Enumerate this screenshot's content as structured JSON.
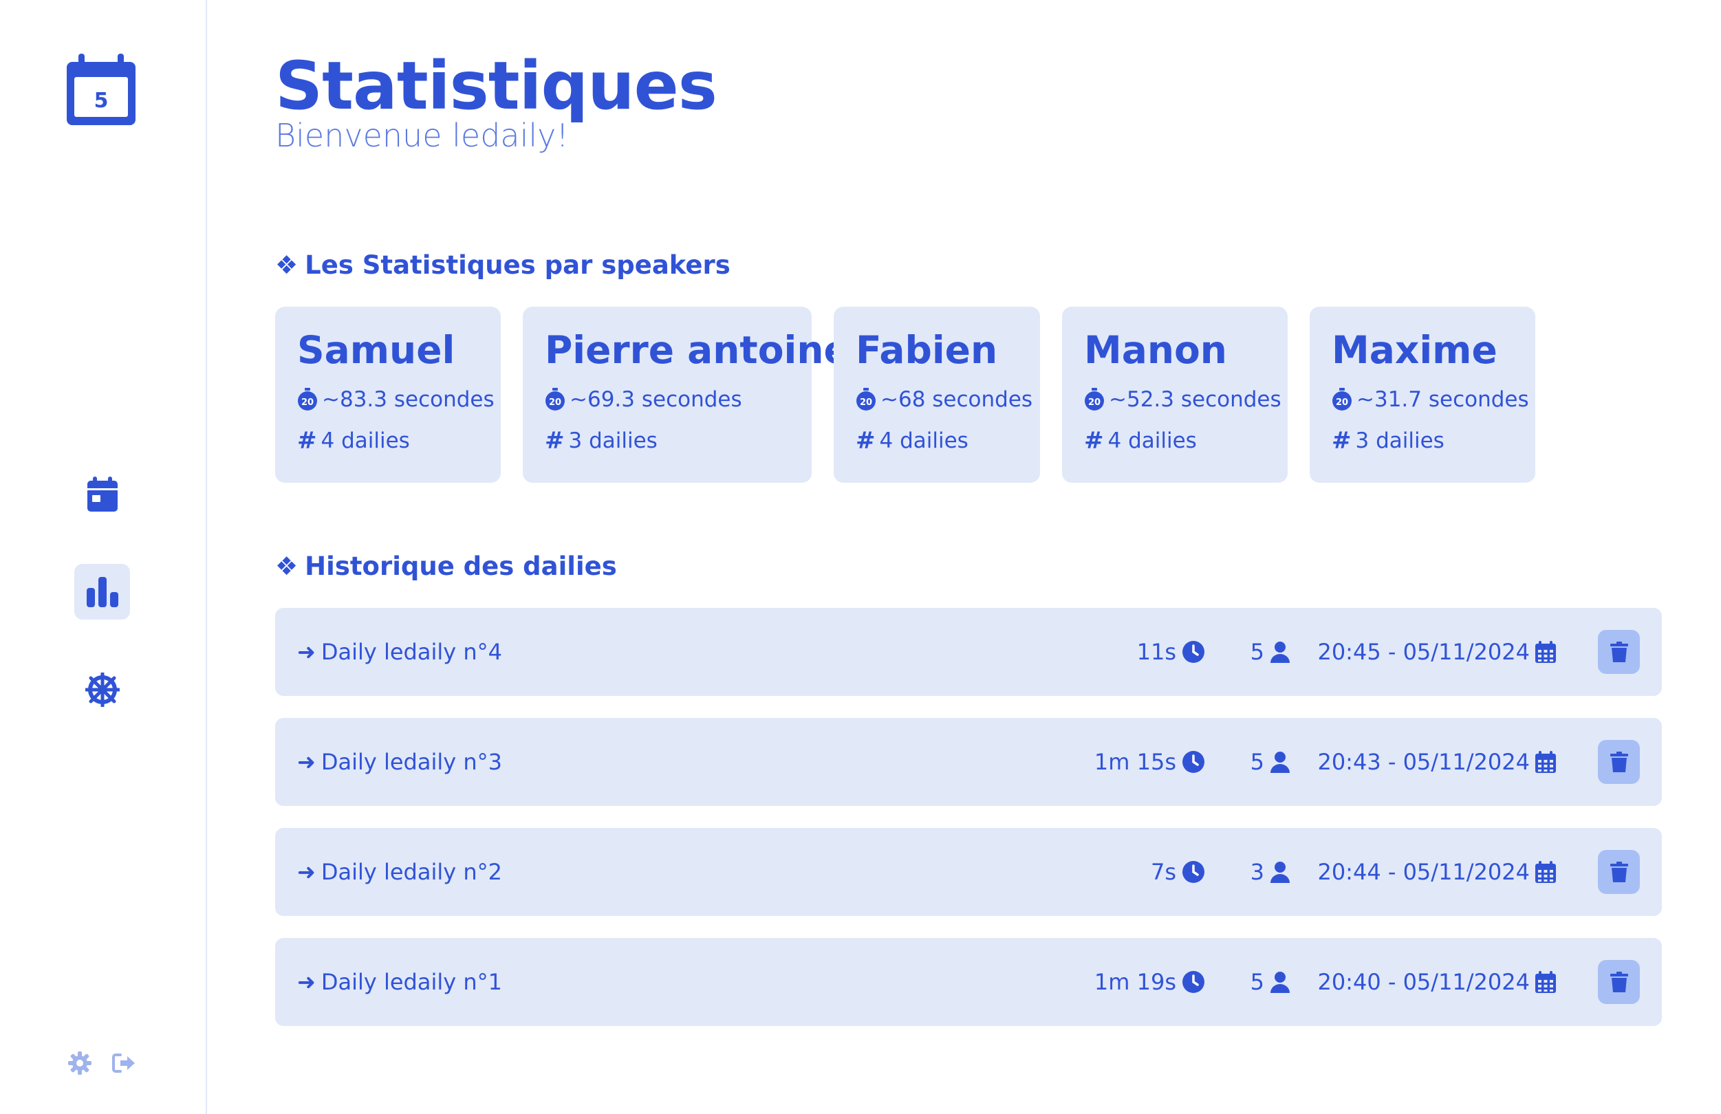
{
  "app": {
    "logo_day": "5"
  },
  "header": {
    "title": "Statistiques",
    "subtitle": "Bienvenue ledaily!"
  },
  "speakers_section": {
    "title": "Les Statistiques par speakers",
    "bullet": "❖"
  },
  "speakers": [
    {
      "name": "Samuel",
      "avg": "~83.3 secondes",
      "dailies": "4 dailies"
    },
    {
      "name": "Pierre antoine",
      "avg": "~69.3 secondes",
      "dailies": "3 dailies"
    },
    {
      "name": "Fabien",
      "avg": "~68 secondes",
      "dailies": "4 dailies"
    },
    {
      "name": "Manon",
      "avg": "~52.3 secondes",
      "dailies": "4 dailies"
    },
    {
      "name": "Maxime",
      "avg": "~31.7 secondes",
      "dailies": "3 dailies"
    }
  ],
  "history_section": {
    "title": "Historique des dailies",
    "bullet": "❖"
  },
  "history": [
    {
      "name": "Daily ledaily n°4",
      "duration": "11s",
      "participants": "5",
      "datetime": "20:45 - 05/11/2024"
    },
    {
      "name": "Daily ledaily n°3",
      "duration": "1m 15s",
      "participants": "5",
      "datetime": "20:43 - 05/11/2024"
    },
    {
      "name": "Daily ledaily n°2",
      "duration": "7s",
      "participants": "3",
      "datetime": "20:44 - 05/11/2024"
    },
    {
      "name": "Daily ledaily n°1",
      "duration": "1m 19s",
      "participants": "5",
      "datetime": "20:40 - 05/11/2024"
    }
  ],
  "icons": {
    "stopwatch_badge": "20",
    "hash": "#",
    "arrow": "➜"
  },
  "colors": {
    "accent": "#3053d6",
    "card_bg": "#e1e8f8",
    "delete_bg": "#a8bff5"
  }
}
